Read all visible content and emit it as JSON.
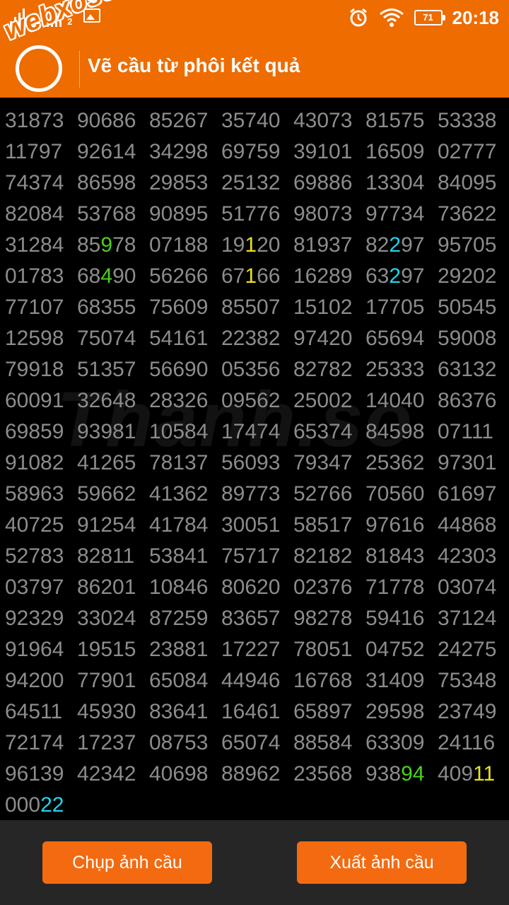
{
  "status_bar": {
    "sim1_label": "1",
    "sim2_label": "2",
    "alarm_icon": "alarm-clock-icon",
    "wifi_icon": "wifi-icon",
    "battery_level": "71",
    "time": "20:18"
  },
  "app_bar": {
    "logo_text": "webxoso.net",
    "title": "Vẽ cầu từ phôi kết quả"
  },
  "watermark": "Thanh.so",
  "colors": {
    "accent": "#ee6c00",
    "number_text": "#8c8c8c",
    "highlight_green": "#4ad21a",
    "highlight_yellow": "#e8e020",
    "highlight_cyan": "#22d4e8",
    "bottom_bar": "#262626"
  },
  "number_rows": [
    [
      [
        "31873"
      ],
      [
        "90686"
      ],
      [
        "85267"
      ],
      [
        "35740"
      ],
      [
        "43073"
      ],
      [
        "81575"
      ],
      [
        "53338"
      ]
    ],
    [
      [
        "11797"
      ],
      [
        "92614"
      ],
      [
        "34298"
      ],
      [
        "69759"
      ],
      [
        "39101"
      ],
      [
        "16509"
      ],
      [
        "02777"
      ]
    ],
    [
      [
        "74374"
      ],
      [
        "86598"
      ],
      [
        "29853"
      ],
      [
        "25132"
      ],
      [
        "69886"
      ],
      [
        "13304"
      ],
      [
        "84095"
      ]
    ],
    [
      [
        "82084"
      ],
      [
        "53768"
      ],
      [
        "90895"
      ],
      [
        "51776"
      ],
      [
        "98073"
      ],
      [
        "97734"
      ],
      [
        "73622"
      ]
    ],
    [
      [
        "31284"
      ],
      [
        "85",
        "9",
        "78"
      ],
      [
        "07188"
      ],
      [
        "19",
        "1",
        "20"
      ],
      [
        "81937"
      ],
      [
        "82",
        "2",
        "97"
      ],
      [
        "95705"
      ]
    ],
    [
      [
        "01783"
      ],
      [
        "68",
        "4",
        "90"
      ],
      [
        "56266"
      ],
      [
        "67",
        "1",
        "66"
      ],
      [
        "16289"
      ],
      [
        "63",
        "2",
        "97"
      ],
      [
        "29202"
      ]
    ],
    [
      [
        "77107"
      ],
      [
        "68355"
      ],
      [
        "75609"
      ],
      [
        "85507"
      ],
      [
        "15102"
      ],
      [
        "17705"
      ],
      [
        "50545"
      ]
    ],
    [
      [
        "12598"
      ],
      [
        "75074"
      ],
      [
        "54161"
      ],
      [
        "22382"
      ],
      [
        "97420"
      ],
      [
        "65694"
      ],
      [
        "59008"
      ]
    ],
    [
      [
        "79918"
      ],
      [
        "51357"
      ],
      [
        "56690"
      ],
      [
        "05356"
      ],
      [
        "82782"
      ],
      [
        "25333"
      ],
      [
        "63132"
      ]
    ],
    [
      [
        "60091"
      ],
      [
        "32648"
      ],
      [
        "28326"
      ],
      [
        "09562"
      ],
      [
        "25002"
      ],
      [
        "14040"
      ],
      [
        "86376"
      ]
    ],
    [
      [
        "69859"
      ],
      [
        "93981"
      ],
      [
        "10584"
      ],
      [
        "17474"
      ],
      [
        "65374"
      ],
      [
        "84598"
      ],
      [
        "07111"
      ]
    ],
    [
      [
        "91082"
      ],
      [
        "41265"
      ],
      [
        "78137"
      ],
      [
        "56093"
      ],
      [
        "79347"
      ],
      [
        "25362"
      ],
      [
        "97301"
      ]
    ],
    [
      [
        "58963"
      ],
      [
        "59662"
      ],
      [
        "41362"
      ],
      [
        "89773"
      ],
      [
        "52766"
      ],
      [
        "70560"
      ],
      [
        "61697"
      ]
    ],
    [
      [
        "40725"
      ],
      [
        "91254"
      ],
      [
        "41784"
      ],
      [
        "30051"
      ],
      [
        "58517"
      ],
      [
        "97616"
      ],
      [
        "44868"
      ]
    ],
    [
      [
        "52783"
      ],
      [
        "82811"
      ],
      [
        "53841"
      ],
      [
        "75717"
      ],
      [
        "82182"
      ],
      [
        "81843"
      ],
      [
        "42303"
      ]
    ],
    [
      [
        "03797"
      ],
      [
        "86201"
      ],
      [
        "10846"
      ],
      [
        "80620"
      ],
      [
        "02376"
      ],
      [
        "71778"
      ],
      [
        "03074"
      ]
    ],
    [
      [
        "92329"
      ],
      [
        "33024"
      ],
      [
        "87259"
      ],
      [
        "83657"
      ],
      [
        "98278"
      ],
      [
        "59416"
      ],
      [
        "37124"
      ]
    ],
    [
      [
        "91964"
      ],
      [
        "19515"
      ],
      [
        "23881"
      ],
      [
        "17227"
      ],
      [
        "78051"
      ],
      [
        "04752"
      ],
      [
        "24275"
      ]
    ],
    [
      [
        "94200"
      ],
      [
        "77901"
      ],
      [
        "65084"
      ],
      [
        "44946"
      ],
      [
        "16768"
      ],
      [
        "31409"
      ],
      [
        "75348"
      ]
    ],
    [
      [
        "64511"
      ],
      [
        "45930"
      ],
      [
        "83641"
      ],
      [
        "16461"
      ],
      [
        "65897"
      ],
      [
        "29598"
      ],
      [
        "23749"
      ]
    ],
    [
      [
        "72174"
      ],
      [
        "17237"
      ],
      [
        "08753"
      ],
      [
        "65074"
      ],
      [
        "88584"
      ],
      [
        "63309"
      ],
      [
        "24116"
      ]
    ],
    [
      [
        "96139"
      ],
      [
        "42342"
      ],
      [
        "40698"
      ],
      [
        "88962"
      ],
      [
        "23568"
      ],
      [
        "938",
        "94",
        ""
      ],
      [
        "409",
        "11",
        ""
      ]
    ],
    [
      [
        "000",
        "22",
        ""
      ]
    ]
  ],
  "highlight_colors": {
    "4-1": "green",
    "4-3": "yellow",
    "4-5": "cyan",
    "5-1": "green",
    "5-3": "yellow",
    "5-5": "cyan",
    "21-5": "green",
    "21-6": "yellow",
    "22-0": "cyan"
  },
  "buttons": {
    "capture_label": "Chụp ảnh cầu",
    "export_label": "Xuất ảnh cầu"
  }
}
